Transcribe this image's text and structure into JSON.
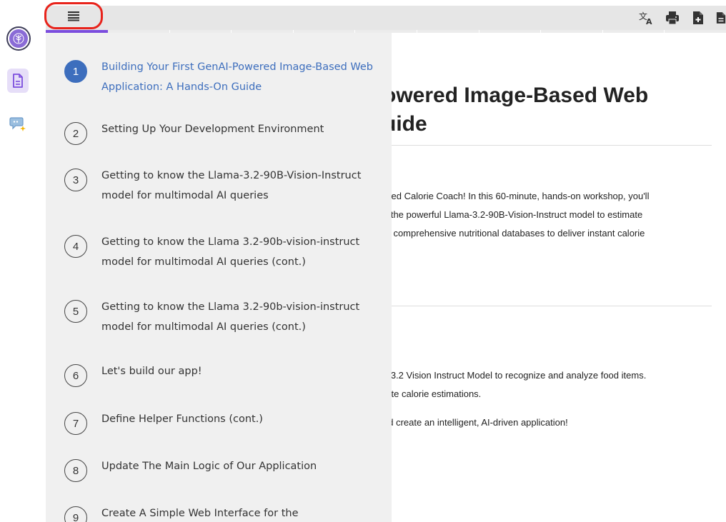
{
  "rail": {
    "items": [
      {
        "name": "logo",
        "icon": "tree-logo-icon"
      },
      {
        "name": "document",
        "icon": "document-icon",
        "active": true
      },
      {
        "name": "ai-chat",
        "icon": "chat-sparkle-icon"
      }
    ]
  },
  "toolbar": {
    "menu_icon": "hamburger-menu-icon",
    "highlight_color": "#e8231b",
    "progress_color": "#7b4dde",
    "icons": [
      "translate-icon",
      "print-icon",
      "add-document-icon",
      "document-icon"
    ]
  },
  "content": {
    "heading_line1": "owered Image-Based Web",
    "heading_line2": "uide",
    "intro": [
      "ered Calorie Coach! In this 60-minute, hands-on workshop, you'll",
      "g the powerful Llama-3.2-90B-Vision-Instruct model to estimate",
      "th comprehensive nutritional databases to deliver instant calorie"
    ],
    "objectives": [
      ".",
      "a 3.2 Vision Instruct Model to recognize and analyze food items.",
      "rate calorie estimations.",
      "nd create an intelligent, AI-driven application!"
    ]
  },
  "toc": {
    "active_color": "#3d6ebd",
    "items": [
      {
        "num": "1",
        "label": "Building Your First GenAI-Powered Image-Based Web Application: A Hands-On Guide",
        "active": true
      },
      {
        "num": "2",
        "label": "Setting Up Your Development Environment"
      },
      {
        "num": "3",
        "label": "Getting to know the Llama-3.2-90B-Vision-Instruct model for multimodal AI queries"
      },
      {
        "num": "4",
        "label": "Getting to know the Llama 3.2-90b-vision-instruct model for multimodal AI queries (cont.)"
      },
      {
        "num": "5",
        "label": "Getting to know the Llama 3.2-90b-vision-instruct model for multimodal AI queries (cont.)"
      },
      {
        "num": "6",
        "label": "Let's build our app!"
      },
      {
        "num": "7",
        "label": "Define Helper Functions (cont.)"
      },
      {
        "num": "8",
        "label": "Update The Main Logic of Our Application"
      },
      {
        "num": "9",
        "label": "Create A Simple Web Interface for the"
      }
    ]
  }
}
